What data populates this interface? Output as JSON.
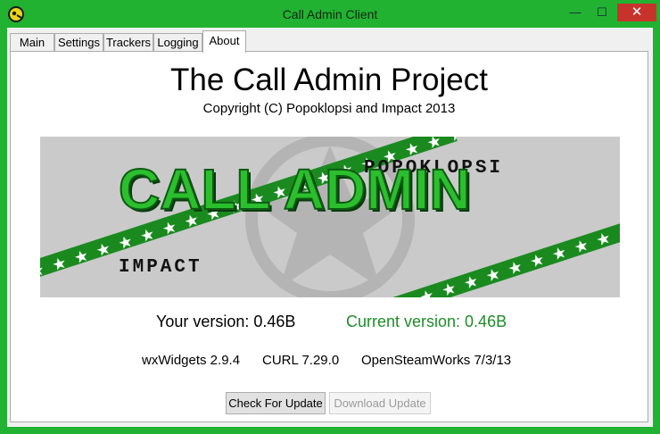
{
  "window": {
    "title": "Call Admin Client",
    "controls": {
      "minimize": "—",
      "maximize": "☐",
      "close": "✕"
    }
  },
  "tabs": [
    {
      "label": "Main",
      "active": false
    },
    {
      "label": "Settings",
      "active": false
    },
    {
      "label": "Trackers",
      "active": false
    },
    {
      "label": "Logging",
      "active": false
    },
    {
      "label": "About",
      "active": true
    }
  ],
  "about": {
    "heading": "The Call Admin Project",
    "copyright": "Copyright (C) Popoklopsi and Impact 2013",
    "banner": {
      "title": "CALL ADMIN",
      "author_top": "POPOKLOPSI",
      "author_bottom": "IMPACT"
    },
    "your_version": "Your version: 0.46B",
    "current_version": "Current version: 0.46B",
    "libraries": {
      "wx": "wxWidgets 2.9.4",
      "curl": "CURL 7.29.0",
      "osw": "OpenSteamWorks 7/3/13"
    },
    "buttons": {
      "check": "Check For Update",
      "download": "Download Update"
    }
  },
  "colors": {
    "frame": "#22b232",
    "close_button": "#c7332b",
    "current_version": "#1e8c2a",
    "banner_green": "#1a8a1f"
  },
  "icons": [
    "app-icon",
    "minimize-icon",
    "maximize-icon",
    "close-icon",
    "star-emblem-icon"
  ]
}
